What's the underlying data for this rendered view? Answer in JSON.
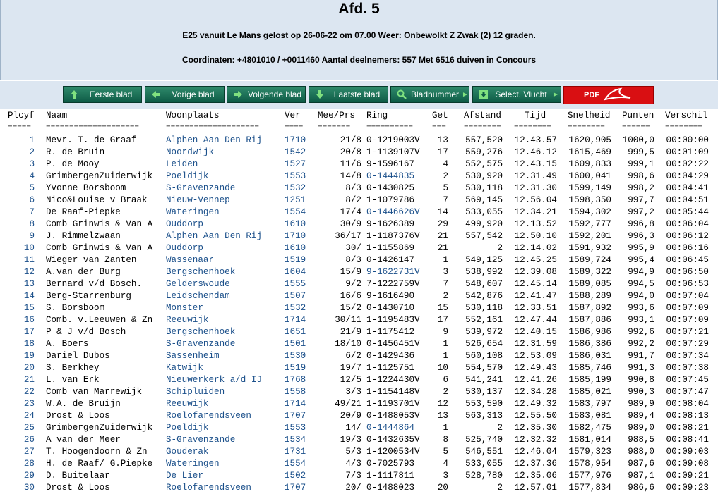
{
  "header": {
    "title": "Afd. 5",
    "line1": "E25 vanuit Le Mans gelost op 26-06-22 om 07.00 Weer: Onbewolkt Z Zwak (2) 12 graden.",
    "line2": "Coordinaten: +4801010 / +0011460 Aantal deelnemers: 557 Met 6516 duiven in Concours"
  },
  "toolbar": {
    "first": "Eerste blad",
    "prev": "Vorige blad",
    "next": "Volgende blad",
    "last": "Laatste blad",
    "pagenum": "Bladnummer",
    "select": "Select. Vlucht",
    "pdf": "PDF"
  },
  "columns": {
    "plcyf": "Plcyf",
    "naam": "Naam",
    "woonplaats": "Woonplaats",
    "ver": "Ver",
    "meeprs": "Mee/Prs",
    "ring": "Ring",
    "get": "Get",
    "afstand": "Afstand",
    "tijd": "Tijd",
    "snelheid": "Snelheid",
    "punten": "Punten",
    "verschil": "Verschil"
  },
  "dashes": {
    "plcyf": "=====",
    "naam": "====================",
    "woonplaats": "====================",
    "ver": "====",
    "meeprs": "=======",
    "ring": "==========",
    "get": "===",
    "afstand": "========",
    "tijd": "========",
    "snelheid": "========",
    "punten": "======",
    "verschil": "========"
  },
  "rows": [
    [
      "1",
      "Mevr. T. de Graaf",
      "Alphen Aan Den Rij",
      "1710",
      "21/8",
      "0-1219003V",
      "13",
      "557,520",
      "12.43.57",
      "1620,905",
      "1000,0",
      "00:00:00"
    ],
    [
      "2",
      "R. de Bruin",
      "Noordwijk",
      "1542",
      "20/8",
      "1-1139107V",
      "17",
      "559,276",
      "12.46.12",
      "1615,469",
      "999,5",
      "00:01:09"
    ],
    [
      "3",
      "P. de Mooy",
      "Leiden",
      "1527",
      "11/6",
      "9-1596167",
      "4",
      "552,575",
      "12.43.15",
      "1609,833",
      "999,1",
      "00:02:22"
    ],
    [
      "4",
      "GrimbergenZuiderwijk",
      "Poeldijk",
      "1553",
      "14/8",
      "0-1444835",
      "2",
      "530,920",
      "12.31.49",
      "1600,041",
      "998,6",
      "00:04:29"
    ],
    [
      "5",
      "Yvonne Borsboom",
      "S-Gravenzande",
      "1532",
      "8/3",
      "0-1430825",
      "5",
      "530,118",
      "12.31.30",
      "1599,149",
      "998,2",
      "00:04:41"
    ],
    [
      "6",
      "Nico&Louise v Braak",
      "Nieuw-Vennep",
      "1251",
      "8/2",
      "1-1079786",
      "7",
      "569,145",
      "12.56.04",
      "1598,350",
      "997,7",
      "00:04:51"
    ],
    [
      "7",
      "De Raaf-Piepke",
      "Wateringen",
      "1554",
      "17/4",
      "0-1446626V",
      "14",
      "533,055",
      "12.34.21",
      "1594,302",
      "997,2",
      "00:05:44"
    ],
    [
      "8",
      "Comb Grinwis & Van A",
      "Ouddorp",
      "1610",
      "30/9",
      "9-1626389",
      "29",
      "499,920",
      "12.13.52",
      "1592,777",
      "996,8",
      "00:06:04"
    ],
    [
      "9",
      "J. Rimmelzwaan",
      "Alphen Aan Den Rij",
      "1710",
      "36/17",
      "1-1187376V",
      "21",
      "557,542",
      "12.50.10",
      "1592,201",
      "996,3",
      "00:06:12"
    ],
    [
      "10",
      "Comb Grinwis & Van A",
      "Ouddorp",
      "1610",
      "30/",
      "1-1155869",
      "21",
      "2",
      "12.14.02",
      "1591,932",
      "995,9",
      "00:06:16"
    ],
    [
      "11",
      "Wieger van Zanten",
      "Wassenaar",
      "1519",
      "8/3",
      "0-1426147",
      "1",
      "549,125",
      "12.45.25",
      "1589,724",
      "995,4",
      "00:06:45"
    ],
    [
      "12",
      "A.van der Burg",
      "Bergschenhoek",
      "1604",
      "15/9",
      "9-1622731V",
      "3",
      "538,992",
      "12.39.08",
      "1589,322",
      "994,9",
      "00:06:50"
    ],
    [
      "13",
      "Bernard v/d Bosch.",
      "Gelderswoude",
      "1555",
      "9/2",
      "7-1222759V",
      "7",
      "548,607",
      "12.45.14",
      "1589,085",
      "994,5",
      "00:06:53"
    ],
    [
      "14",
      "Berg-Starrenburg",
      "Leidschendam",
      "1507",
      "16/6",
      "9-1616490",
      "2",
      "542,876",
      "12.41.47",
      "1588,289",
      "994,0",
      "00:07:04"
    ],
    [
      "15",
      "S. Borsboom",
      "Monster",
      "1532",
      "15/2",
      "0-1430710",
      "15",
      "530,118",
      "12.33.51",
      "1587,892",
      "993,6",
      "00:07:09"
    ],
    [
      "16",
      "Comb. v.Leeuwen & Zn",
      "Reeuwijk",
      "1714",
      "30/11",
      "1-1195483V",
      "17",
      "552,161",
      "12.47.44",
      "1587,886",
      "993,1",
      "00:07:09"
    ],
    [
      "17",
      "P & J v/d Bosch",
      "Bergschenhoek",
      "1651",
      "21/9",
      "1-1175412",
      "9",
      "539,972",
      "12.40.15",
      "1586,986",
      "992,6",
      "00:07:21"
    ],
    [
      "18",
      "A. Boers",
      "S-Gravenzande",
      "1501",
      "18/10",
      "0-1456451V",
      "1",
      "526,654",
      "12.31.59",
      "1586,386",
      "992,2",
      "00:07:29"
    ],
    [
      "19",
      "Dariel Dubos",
      "Sassenheim",
      "1530",
      "6/2",
      "0-1429436",
      "1",
      "560,108",
      "12.53.09",
      "1586,031",
      "991,7",
      "00:07:34"
    ],
    [
      "20",
      "S. Berkhey",
      "Katwijk",
      "1519",
      "19/7",
      "1-1125751",
      "10",
      "554,570",
      "12.49.43",
      "1585,746",
      "991,3",
      "00:07:38"
    ],
    [
      "21",
      "L. van Erk",
      "Nieuwerkerk a/d IJ",
      "1768",
      "12/5",
      "1-1224430V",
      "6",
      "541,241",
      "12.41.26",
      "1585,199",
      "990,8",
      "00:07:45"
    ],
    [
      "22",
      "Comb van Marrewijk",
      "Schipluiden",
      "1558",
      "3/3",
      "1-1154148V",
      "2",
      "530,137",
      "12.34.28",
      "1585,021",
      "990,3",
      "00:07:47"
    ],
    [
      "23",
      "W.A. de Bruijn",
      "Reeuwijk",
      "1714",
      "49/21",
      "1-1193701V",
      "12",
      "553,590",
      "12.49.32",
      "1583,797",
      "989,9",
      "00:08:04"
    ],
    [
      "24",
      "Drost & Loos",
      "Roelofarendsveen",
      "1707",
      "20/9",
      "0-1488053V",
      "13",
      "563,313",
      "12.55.50",
      "1583,081",
      "989,4",
      "00:08:13"
    ],
    [
      "25",
      "GrimbergenZuiderwijk",
      "Poeldijk",
      "1553",
      "14/",
      "0-1444864",
      "1",
      "2",
      "12.35.30",
      "1582,475",
      "989,0",
      "00:08:21"
    ],
    [
      "26",
      "A van der Meer",
      "S-Gravenzande",
      "1534",
      "19/3",
      "0-1432635V",
      "8",
      "525,740",
      "12.32.32",
      "1581,014",
      "988,5",
      "00:08:41"
    ],
    [
      "27",
      "T. Hoogendoorn & Zn",
      "Gouderak",
      "1731",
      "5/3",
      "1-1200534V",
      "5",
      "546,551",
      "12.46.04",
      "1579,323",
      "988,0",
      "00:09:03"
    ],
    [
      "28",
      "H. de Raaf/ G.Piepke",
      "Wateringen",
      "1554",
      "4/3",
      "0-7025793",
      "4",
      "533,055",
      "12.37.36",
      "1578,954",
      "987,6",
      "00:09:08"
    ],
    [
      "29",
      "D. Buitelaar",
      "De Lier",
      "1502",
      "7/3",
      "1-1117811",
      "3",
      "528,780",
      "12.35.06",
      "1577,976",
      "987,1",
      "00:09:21"
    ],
    [
      "30",
      "Drost & Loos",
      "Roelofarendsveen",
      "1707",
      "20/",
      "0-1488023",
      "20",
      "2",
      "12.57.01",
      "1577,834",
      "986,6",
      "00:09:23"
    ]
  ],
  "blue_rings": [
    "0-1444835",
    "0-1446626V",
    "9-1622731V",
    "0-1444864"
  ]
}
